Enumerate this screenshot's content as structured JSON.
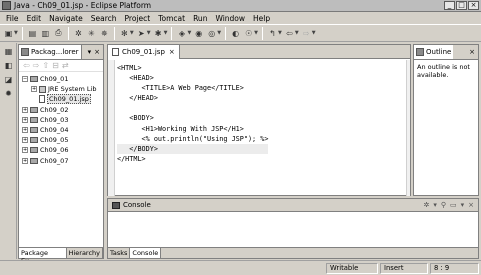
{
  "window": {
    "title": "Java - Ch09_01.jsp - Eclipse Platform",
    "minimize": "_",
    "maximize": "□",
    "close": "×"
  },
  "menu": [
    "File",
    "Edit",
    "Navigate",
    "Search",
    "Project",
    "Tomcat",
    "Run",
    "Window",
    "Help"
  ],
  "package_explorer": {
    "title": "Packag...lorer",
    "tree": [
      {
        "label": "Ch09_01",
        "expanded": true
      },
      {
        "label": "JRE System Lib",
        "indent": 2
      },
      {
        "label": "Ch09_01.jsp",
        "indent": 2
      },
      {
        "label": "Ch09_02"
      },
      {
        "label": "Ch09_03"
      },
      {
        "label": "Ch09_04"
      },
      {
        "label": "Ch09_05"
      },
      {
        "label": "Ch09_06"
      },
      {
        "label": "Ch09_07"
      }
    ],
    "bottom_tabs": [
      "Package Ex...",
      "Hierarchy"
    ]
  },
  "editor": {
    "tab": "Ch09_01.jsp",
    "lines": [
      "<HTML>",
      "   <HEAD>",
      "      <TITLE>A Web Page</TITLE>",
      "   </HEAD>",
      "",
      "   <BODY>",
      "      <H1>Working With JSP</H1>",
      "      <% out.println(\"Using JSP\"); %>",
      "   </BODY>",
      "</HTML>"
    ]
  },
  "outline": {
    "title": "Outline",
    "message": "An outline is not available."
  },
  "console": {
    "title": "Console",
    "bottom_tabs": [
      "Tasks",
      "Console"
    ]
  },
  "status": {
    "mode": "Writable",
    "insert": "Insert",
    "position": "8 : 9"
  }
}
